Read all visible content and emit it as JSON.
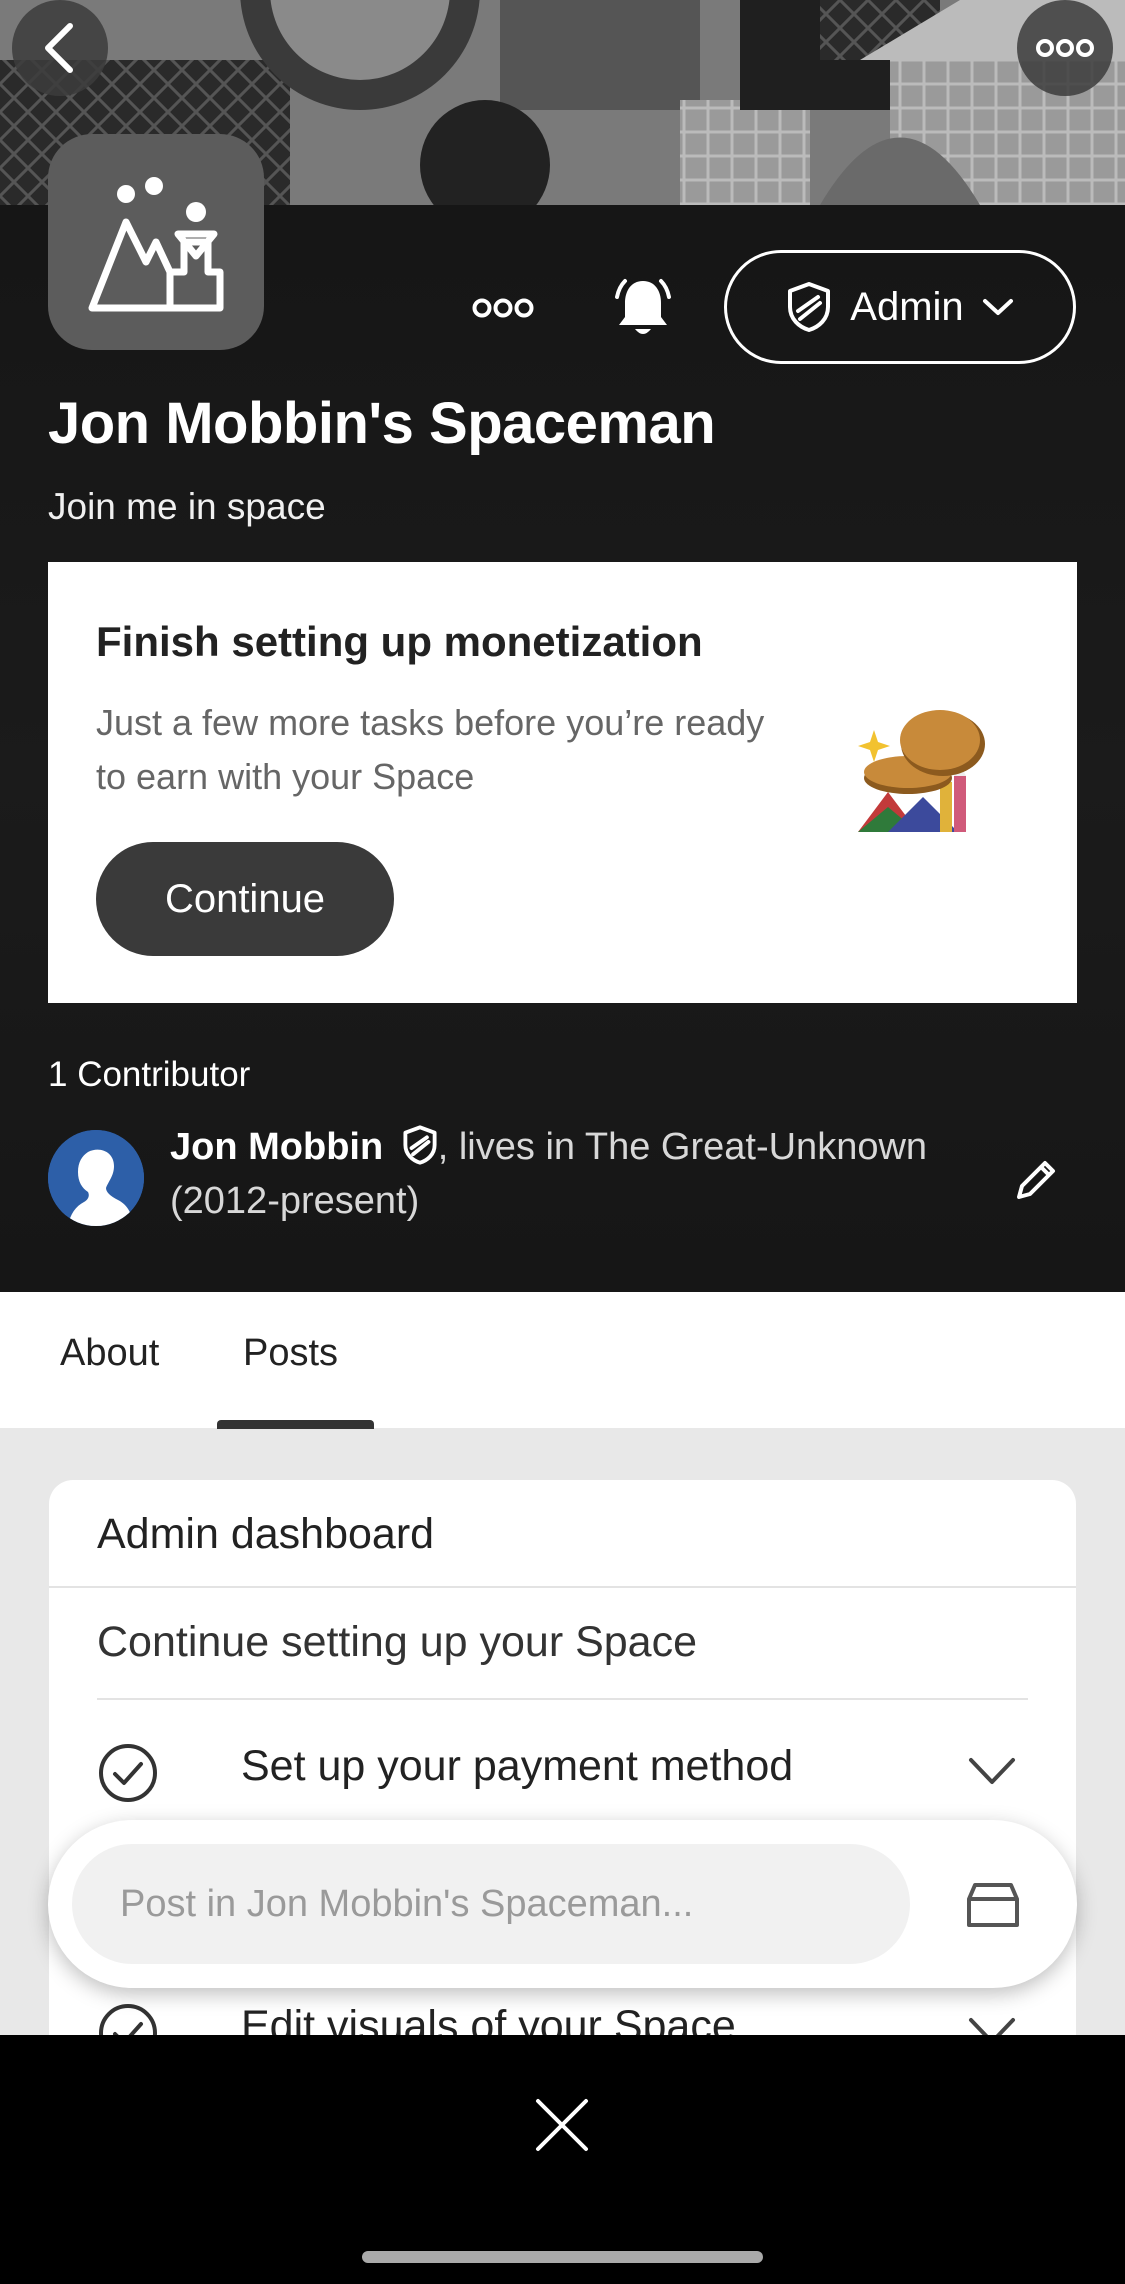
{
  "header": {
    "back_icon": "chevron-left-icon",
    "more_icon": "more-horizontal-icon",
    "space_logo_icon": "space-logo-icon",
    "actions": {
      "more_icon": "more-horizontal-icon",
      "bell_icon": "bell-icon",
      "admin_label": "Admin",
      "admin_icon": "shield-icon"
    },
    "title": "Jon Mobbin's Spaceman",
    "subtitle": "Join me in space"
  },
  "monetization": {
    "title": "Finish setting up monetization",
    "description": "Just a few more tasks before you’re ready to earn with your Space",
    "button_label": "Continue"
  },
  "contributors": {
    "heading": "1 Contributor",
    "items": [
      {
        "name": "Jon Mobbin",
        "credential": ", lives in The Great-Unknown (2012-present)"
      }
    ]
  },
  "tabs": [
    {
      "label": "About",
      "active": false
    },
    {
      "label": "Posts",
      "active": true
    }
  ],
  "dashboard": {
    "title": "Admin dashboard",
    "subtitle": "Continue setting up your Space",
    "tasks": [
      {
        "label": "Set up your payment method"
      },
      {
        "label": "Edit visuals of your Space"
      }
    ]
  },
  "composer": {
    "placeholder": "Post in Jon Mobbin's Spaceman..."
  },
  "colors": {
    "hero_bg": "#1a1a1a",
    "card_bg": "#ffffff",
    "dark_button": "#3a3a3a",
    "avatar_blue": "#2d5fa8"
  }
}
